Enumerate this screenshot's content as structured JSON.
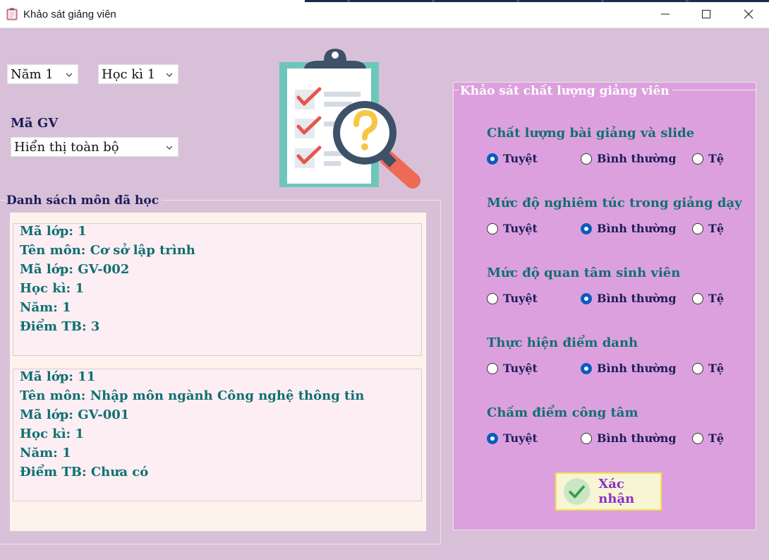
{
  "window": {
    "title": "Khảo sát giảng viên"
  },
  "filters": {
    "year": "Năm 1",
    "term": "Học kì 1",
    "gv_label": "Mã GV",
    "gv_value": "Hiển thị toàn bộ"
  },
  "list": {
    "title": "Danh sách môn đã học",
    "cards": [
      {
        "lines": [
          "Mã lớp: 1",
          "Tên môn: Cơ sở lập trình",
          "Mã lớp: GV-002",
          "Học kì: 1",
          "Năm: 1",
          "Điểm TB: 3"
        ]
      },
      {
        "lines": [
          "Mã lớp: 11",
          "Tên môn: Nhập môn ngành Công nghệ thông tin",
          "Mã lớp: GV-001",
          "Học kì: 1",
          "Năm: 1",
          "Điểm TB: Chưa có"
        ]
      }
    ]
  },
  "survey": {
    "title": "Khảo sát chất lượng giảng viên",
    "options": [
      "Tuyệt",
      "Bình thường",
      "Tệ"
    ],
    "questions": [
      {
        "title": "Chất lượng bài giảng và slide",
        "selected": 0
      },
      {
        "title": "Mức độ nghiêm túc trong giảng dạy",
        "selected": 1
      },
      {
        "title": "Mức độ quan tâm sinh viên",
        "selected": 1
      },
      {
        "title": "Thực hiện điểm danh",
        "selected": 1
      },
      {
        "title": "Chấm điểm công tâm",
        "selected": 0
      }
    ],
    "confirm_label": "Xác nhận"
  },
  "icons": {
    "app": "clipboard-icon",
    "illustration": "clipboard-search-icon",
    "confirm": "check-circle-icon",
    "chevron": "chevron-down-icon"
  },
  "colors": {
    "background": "#d8c1d8",
    "survey_panel": "#dda0de",
    "text_teal": "#0f7070",
    "text_navy": "#1c1c5a",
    "radio_selected": "#0a5cc0",
    "confirm_text": "#8b2fc9"
  }
}
